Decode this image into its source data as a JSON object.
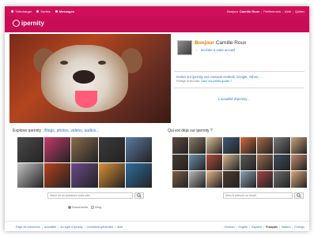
{
  "topbar": {
    "left_links": [
      "Télécharger",
      "Sorties",
      "Messages"
    ],
    "greeting": "Bonjour",
    "user": "Camille Roux",
    "right_links": [
      "Préférences",
      "Aide",
      "Quitter"
    ]
  },
  "brand": {
    "logo": "ipernity"
  },
  "login": {
    "greeting": "Bonjour",
    "name": "Camille Roux",
    "access_link": "accéder à votre accueil",
    "contacts_title": "Invitez sur ipernity vos contacts Hotmail, Google, Yahoo, …",
    "contacts_sub": "Protégé et sécurisé.",
    "contacts_sub_link": "Lisez nos petites guides ?",
    "news_link": "L'actualité d'ipernity..."
  },
  "explore": {
    "title_prefix": "Explorer ipernity :",
    "title_links": "Blogs, photos, vidéos, audios...",
    "search_placeholder": "Saisir un ou plusieurs mots-clés",
    "radio_documents": "Documents",
    "radio_blog": "Blog",
    "thumb_colors": [
      "#4b4b4b",
      "#c33a6b",
      "#8a6a4d",
      "#3b3b3b",
      "#5a7aa3",
      "#c2c2c2",
      "#b8401d",
      "#6a4a8a",
      "#d98f36",
      "#2e6d9e"
    ]
  },
  "who": {
    "title": "Qui est déjà sur ipernity ?",
    "search_placeholder": "Nom & prénom ou email",
    "thumb_colors": [
      "#5d4c3e",
      "#8c7a6a",
      "#e0c19b",
      "#3f5a76",
      "#d46b3a",
      "#a66b4a",
      "#7a7a7a",
      "#c9a27a",
      "#4a3b2f",
      "#6e8fa8",
      "#b44d3a",
      "#d2b48c",
      "#5a5a5a",
      "#9a6e4a",
      "#3e4e5e",
      "#c08a6a",
      "#7d5c44",
      "#b7b7b7",
      "#e6b38a",
      "#4d3a30",
      "#8aa0b5",
      "#a34444",
      "#6b6b6b",
      "#d9a679"
    ]
  },
  "footer": {
    "left": [
      "Page de connexion",
      "Actualités",
      "Au sujet d'ipernity",
      "Conditions générales",
      "Aide"
    ],
    "right": [
      "Deutsch",
      "English",
      "Español",
      "Français",
      "Italiano",
      "Portugu"
    ]
  }
}
